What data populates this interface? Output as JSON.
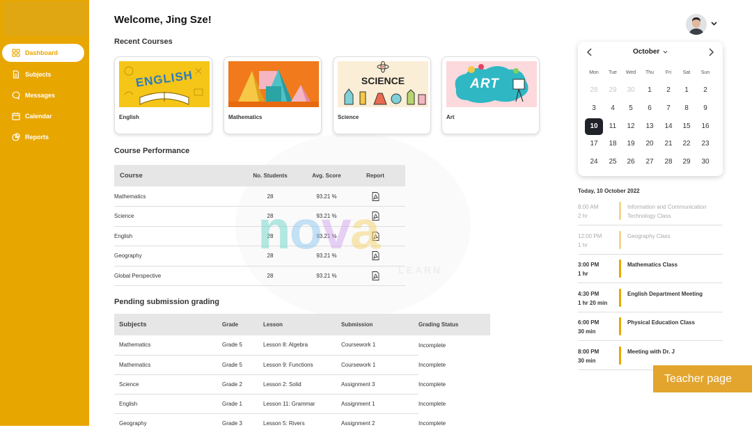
{
  "sidebar": {
    "items": [
      {
        "label": "Dashboard",
        "active": true,
        "icon": "grid-icon"
      },
      {
        "label": "Subjects",
        "active": false,
        "icon": "document-icon"
      },
      {
        "label": "Messages",
        "active": false,
        "icon": "chat-icon"
      },
      {
        "label": "Calendar",
        "active": false,
        "icon": "calendar-icon"
      },
      {
        "label": "Reports",
        "active": false,
        "icon": "pie-chart-icon"
      }
    ]
  },
  "header": {
    "welcome": "Welcome, Jing Sze!"
  },
  "recent_courses": {
    "title": "Recent Courses",
    "items": [
      {
        "label": "English",
        "thumb_text": "ENGLISH"
      },
      {
        "label": "Mathematics",
        "thumb_text": ""
      },
      {
        "label": "Science",
        "thumb_text": "SCIENCE"
      },
      {
        "label": "Art",
        "thumb_text": "ART"
      }
    ]
  },
  "performance": {
    "title": "Course Performance",
    "columns": [
      "Course",
      "No. Students",
      "Avg. Score",
      "Report"
    ],
    "rows": [
      {
        "course": "Mathematics",
        "students": "28",
        "score": "93.21 %"
      },
      {
        "course": "Science",
        "students": "28",
        "score": "93.21 %"
      },
      {
        "course": "English",
        "students": "28",
        "score": "93.21 %"
      },
      {
        "course": "Geography",
        "students": "28",
        "score": "93.21 %"
      },
      {
        "course": "Global Perspective",
        "students": "28",
        "score": "93.21 %"
      }
    ]
  },
  "pending": {
    "title": "Pending submission grading",
    "columns": [
      "Subjects",
      "Grade",
      "Lesson",
      "Submission",
      "Grading Status"
    ],
    "rows": [
      {
        "subject": "Mathematics",
        "grade": "Grade 5",
        "lesson": "Lesson 8: Algebra",
        "submission": "Coursework 1",
        "status": "Incomplete"
      },
      {
        "subject": "Mathematics",
        "grade": "Grade 5",
        "lesson": "Lesson 9: Functions",
        "submission": "Coursework 1",
        "status": "Incomplete"
      },
      {
        "subject": "Science",
        "grade": "Grade 2",
        "lesson": "Lesson 2: Solid",
        "submission": "Assignment 3",
        "status": "Incomplete"
      },
      {
        "subject": "English",
        "grade": "Grade 1",
        "lesson": "Lesson 11: Grammar",
        "submission": "Assignment 1",
        "status": "Incomplete"
      },
      {
        "subject": "Geography",
        "grade": "Grade 3",
        "lesson": "Lesson 5: Rivers",
        "submission": "Assignment 2",
        "status": "Incomplete"
      }
    ]
  },
  "watermark": {
    "logo": "nova",
    "sub": "LEARN"
  },
  "calendar": {
    "month": "October",
    "weekdays": [
      "Mon",
      "Tue",
      "Wed",
      "Thu",
      "Fri",
      "Sat",
      "Sun"
    ],
    "weeks": [
      [
        {
          "d": "28",
          "m": true
        },
        {
          "d": "29",
          "m": true
        },
        {
          "d": "30",
          "m": true
        },
        {
          "d": "1"
        },
        {
          "d": "2"
        },
        {
          "d": "1"
        },
        {
          "d": "2"
        }
      ],
      [
        {
          "d": "3"
        },
        {
          "d": "4"
        },
        {
          "d": "5"
        },
        {
          "d": "6"
        },
        {
          "d": "7"
        },
        {
          "d": "8"
        },
        {
          "d": "9"
        }
      ],
      [
        {
          "d": "10",
          "s": true
        },
        {
          "d": "11"
        },
        {
          "d": "12"
        },
        {
          "d": "13"
        },
        {
          "d": "14"
        },
        {
          "d": "15"
        },
        {
          "d": "16"
        }
      ],
      [
        {
          "d": "17"
        },
        {
          "d": "18"
        },
        {
          "d": "19"
        },
        {
          "d": "20"
        },
        {
          "d": "21"
        },
        {
          "d": "22"
        },
        {
          "d": "23"
        }
      ],
      [
        {
          "d": "24"
        },
        {
          "d": "25"
        },
        {
          "d": "26"
        },
        {
          "d": "27"
        },
        {
          "d": "28"
        },
        {
          "d": "29"
        },
        {
          "d": "30"
        }
      ]
    ]
  },
  "schedule": {
    "today": "Today, 10 October 2022",
    "events": [
      {
        "time": "8:00 AM",
        "duration": "2 hr",
        "title": "Information and Communication Technology Class",
        "past": true
      },
      {
        "time": "12:00 PM",
        "duration": "1 hr",
        "title": "Geography Class",
        "past": true
      },
      {
        "time": "3:00 PM",
        "duration": "1 hr",
        "title": "Mathematics Class",
        "past": false
      },
      {
        "time": "4:30 PM",
        "duration": "1 hr 20 min",
        "title": "English Department Meeting",
        "past": false
      },
      {
        "time": "6:00 PM",
        "duration": "30 min",
        "title": "Physical Education Class",
        "past": false
      },
      {
        "time": "8:00 PM",
        "duration": "30 min",
        "title": "Meeting with Dr. J",
        "past": false
      }
    ]
  },
  "tag": {
    "label": "Teacher page"
  },
  "colors": {
    "accent": "#e8a600",
    "selected_day": "#1f2229"
  }
}
